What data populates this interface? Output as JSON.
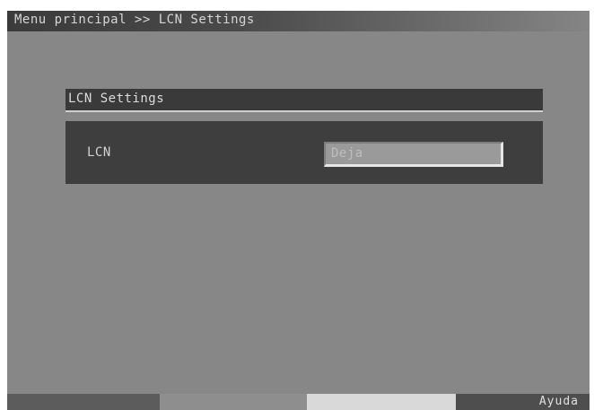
{
  "header": {
    "breadcrumb": "Menu principal >> LCN Settings"
  },
  "panel": {
    "title": "LCN Settings",
    "rows": [
      {
        "label": "LCN",
        "value": "Deja"
      }
    ]
  },
  "footer": {
    "keys": [
      {
        "label": "",
        "color": "#5c5c5c"
      },
      {
        "label": "",
        "color": "#8e8e8e"
      },
      {
        "label": "",
        "color": "#d9d9d9"
      },
      {
        "label": "Ayuda",
        "color": "#4e4e4e"
      }
    ]
  }
}
